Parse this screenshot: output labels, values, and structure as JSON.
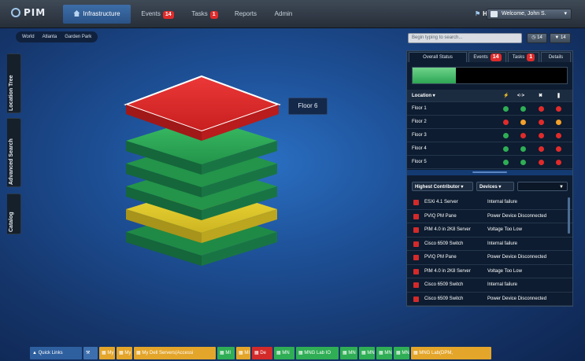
{
  "app": {
    "logo": "PIM"
  },
  "nav": {
    "items": [
      {
        "label": "Infrastructure",
        "badge": ""
      },
      {
        "label": "Events",
        "badge": "14"
      },
      {
        "label": "Tasks",
        "badge": "1"
      },
      {
        "label": "Reports",
        "badge": ""
      },
      {
        "label": "Admin",
        "badge": ""
      }
    ],
    "help": "Help",
    "welcome": "Welcome, John S."
  },
  "breadcrumb": [
    "World",
    "Atlanta",
    "Garden Park"
  ],
  "side_tabs": [
    "Location Tree",
    "Advanced Search",
    "Catalog"
  ],
  "search": {
    "placeholder": "Begin typing to search..."
  },
  "counters": {
    "events": "14",
    "tasks": "14"
  },
  "floor_label": "Floor 6",
  "panel": {
    "tabs": [
      "Overall Status",
      "Events",
      "Tasks",
      "Details"
    ],
    "tab_badges": {
      "events": "14",
      "tasks": "1"
    },
    "status_level": 0.28,
    "location_header": "Location",
    "floors": [
      {
        "name": "Floor 1",
        "status": [
          "green",
          "green",
          "red",
          "red"
        ]
      },
      {
        "name": "Floor 2",
        "status": [
          "red",
          "orange",
          "red",
          "orange"
        ]
      },
      {
        "name": "Floor 3",
        "status": [
          "green",
          "red",
          "red",
          "red"
        ]
      },
      {
        "name": "Floor 4",
        "status": [
          "green",
          "green",
          "red",
          "red"
        ]
      },
      {
        "name": "Floor 5",
        "status": [
          "green",
          "green",
          "red",
          "red"
        ]
      }
    ],
    "filter1": "Highest Contributor",
    "filter2": "Devices",
    "events": [
      {
        "device": "ESXi 4.1 Server",
        "message": "Internal failure"
      },
      {
        "device": "PVIQ PM Pane",
        "message": "Power Device Disconnected"
      },
      {
        "device": "PIM 4.0 in 2K8 Server",
        "message": "Voltage Too Low"
      },
      {
        "device": "Cisco 6509 Switch",
        "message": "Internal failure"
      },
      {
        "device": "PVIQ PM Pane",
        "message": "Power Device Disconnected"
      },
      {
        "device": "PIM 4.0 in 2K8 Server",
        "message": "Voltage Too Low"
      },
      {
        "device": "Cisco 6509 Switch",
        "message": "Internal failure"
      },
      {
        "device": "Cisco 6509 Switch",
        "message": "Power Device Disconnected"
      }
    ]
  },
  "colors": {
    "red": "#e02b2b",
    "green": "#2fae55",
    "orange": "#f2a12b",
    "yellow": "#e8d12f",
    "accent": "#2a5287"
  },
  "taskbar": {
    "quick_links": "Quick Links",
    "items": [
      "My",
      "My",
      "My Dell Servers(Accessi",
      "MI",
      "MI",
      "De",
      "MN",
      "MNG Lab IO",
      "MN",
      "MN",
      "MN",
      "MN",
      "MNG Lab(DPM,"
    ]
  }
}
